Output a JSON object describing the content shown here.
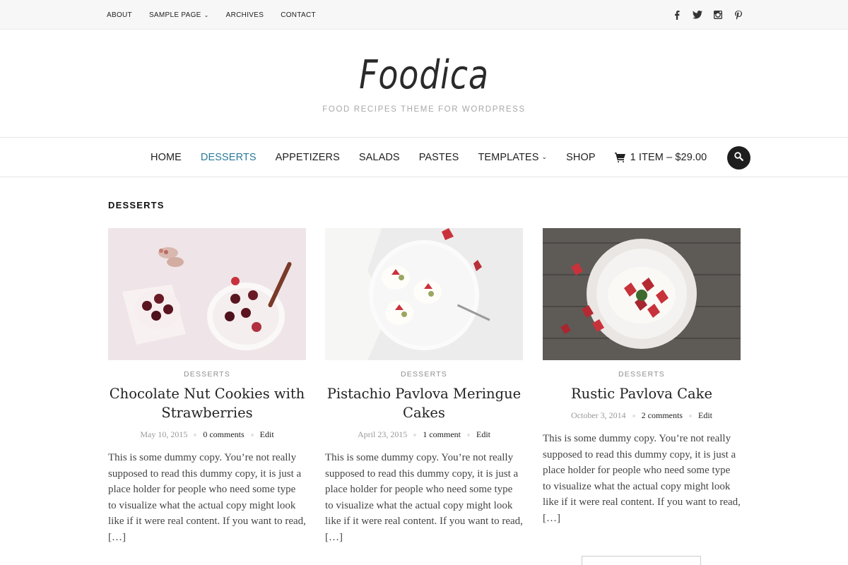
{
  "topnav": {
    "items": [
      {
        "label": "ABOUT"
      },
      {
        "label": "SAMPLE PAGE",
        "has_dropdown": true
      },
      {
        "label": "ARCHIVES"
      },
      {
        "label": "CONTACT"
      }
    ]
  },
  "social": [
    "facebook-icon",
    "twitter-icon",
    "instagram-icon",
    "pinterest-icon"
  ],
  "header": {
    "logo": "Foodica",
    "tagline": "FOOD RECIPES THEME FOR WORDPRESS"
  },
  "mainnav": {
    "items": [
      {
        "label": "HOME"
      },
      {
        "label": "DESSERTS",
        "active": true
      },
      {
        "label": "APPETIZERS"
      },
      {
        "label": "SALADS"
      },
      {
        "label": "PASTES"
      },
      {
        "label": "TEMPLATES",
        "has_dropdown": true
      },
      {
        "label": "SHOP"
      }
    ],
    "cart": "1 ITEM – $29.00",
    "active_color": "#2b7a9a"
  },
  "section_title": "DESSERTS",
  "posts": [
    {
      "category": "DESSERTS",
      "title": "Chocolate Nut Cookies with Strawberries",
      "date": "May 10, 2015",
      "comments": "0 comments",
      "edit": "Edit",
      "excerpt": "This is some dummy copy. You’re not really supposed to read this dummy copy, it is just a place holder for people who need some type to visualize what the actual copy might look like if it were real content. If you want to read, […]"
    },
    {
      "category": "DESSERTS",
      "title": "Pistachio Pavlova Meringue Cakes",
      "date": "April 23, 2015",
      "comments": "1 comment",
      "edit": "Edit",
      "excerpt": "This is some dummy copy. You’re not really supposed to read this dummy copy, it is just a place holder for people who need some type to visualize what the actual copy might look like if it were real content. If you want to read, […]"
    },
    {
      "category": "DESSERTS",
      "title": "Rustic Pavlova Cake",
      "date": "October 3, 2014",
      "comments": "2 comments",
      "edit": "Edit",
      "excerpt": "This is some dummy copy. You’re not really supposed to read this dummy copy, it is just a place holder for people who need some type to visualize what the actual copy might look like if it were real content. If you want to read, […]"
    }
  ]
}
